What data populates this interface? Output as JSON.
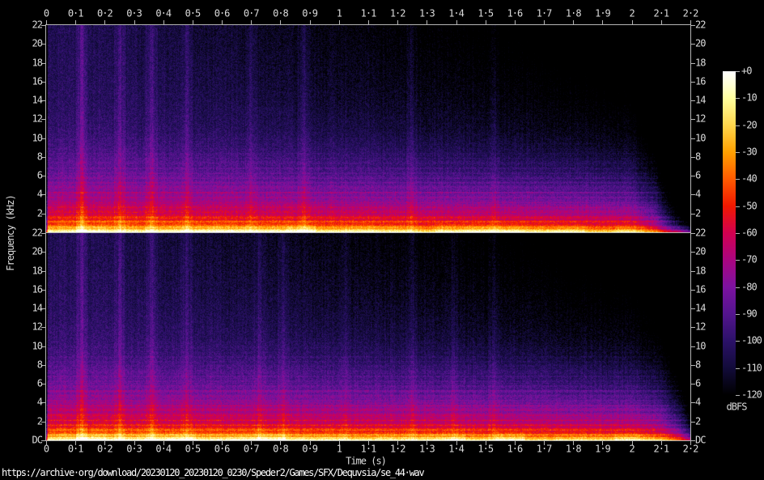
{
  "colors": {
    "background": "#000000",
    "text": "#dcdcdc",
    "axis": "#b4b4b4",
    "caption_text": "#ffffff"
  },
  "chart_data": {
    "type": "heatmap",
    "subtype": "audio-spectrogram-stereo",
    "xlabel": "Time (s)",
    "ylabel": "Frequency (kHz)",
    "x_range_s": [
      0,
      2.2
    ],
    "y_range_khz": [
      0,
      22
    ],
    "z_range_dbfs": [
      -120,
      0
    ],
    "x_ticks": [
      "0",
      "0·1",
      "0·2",
      "0·3",
      "0·4",
      "0·5",
      "0·6",
      "0·7",
      "0·8",
      "0·9",
      "1",
      "1·1",
      "1·2",
      "1·3",
      "1·4",
      "1·5",
      "1·6",
      "1·7",
      "1·8",
      "1·9",
      "2",
      "2·1",
      "2·2"
    ],
    "y_ticks_top_panel": [
      "22",
      "20",
      "18",
      "16",
      "14",
      "12",
      "10",
      "8",
      "6",
      "4",
      "2"
    ],
    "y_ticks_bottom_panel": [
      "22",
      "20",
      "18",
      "16",
      "14",
      "12",
      "10",
      "8",
      "6",
      "4",
      "2",
      "DC"
    ],
    "colorbar": {
      "unit": "dBFS",
      "ticks": [
        "+0",
        "-10",
        "-20",
        "-30",
        "-40",
        "-50",
        "-60",
        "-70",
        "-80",
        "-90",
        "-100",
        "-110",
        "-120"
      ],
      "palette": [
        {
          "db": 0,
          "color": "#ffffff"
        },
        {
          "db": -5,
          "color": "#ffffd5"
        },
        {
          "db": -10,
          "color": "#ffff9e"
        },
        {
          "db": -20,
          "color": "#ffd64c"
        },
        {
          "db": -30,
          "color": "#ffa000"
        },
        {
          "db": -40,
          "color": "#ff5a00"
        },
        {
          "db": -50,
          "color": "#f01800"
        },
        {
          "db": -60,
          "color": "#d20050"
        },
        {
          "db": -70,
          "color": "#aa0580"
        },
        {
          "db": -80,
          "color": "#7c12a0"
        },
        {
          "db": -90,
          "color": "#53148e"
        },
        {
          "db": -100,
          "color": "#2b1168"
        },
        {
          "db": -110,
          "color": "#120b3a"
        },
        {
          "db": -120,
          "color": "#000000"
        }
      ]
    },
    "freq_profile_khz_dbfs": [
      [
        22,
        -103
      ],
      [
        18,
        -102
      ],
      [
        14,
        -100
      ],
      [
        11,
        -97
      ],
      [
        9,
        -93
      ],
      [
        7,
        -87
      ],
      [
        5.5,
        -81
      ],
      [
        4,
        -74
      ],
      [
        3,
        -68
      ],
      [
        2.2,
        -61
      ],
      [
        1.6,
        -54
      ],
      [
        1.1,
        -46
      ],
      [
        0.8,
        -39
      ],
      [
        0.55,
        -32
      ],
      [
        0.35,
        -24
      ],
      [
        0.2,
        -16
      ],
      [
        0.1,
        -10
      ],
      [
        0,
        -8
      ]
    ],
    "panels": [
      {
        "channel": "left",
        "seed": 7,
        "envelope_s_dbfs": [
          [
            0,
            -2
          ],
          [
            0.06,
            0
          ],
          [
            0.6,
            -3
          ],
          [
            1.2,
            -7
          ],
          [
            1.7,
            -11
          ],
          [
            2.0,
            -15
          ],
          [
            2.08,
            -30
          ],
          [
            2.14,
            -60
          ],
          [
            2.2,
            -90
          ]
        ],
        "transients_s_db": [
          [
            0.12,
            16
          ],
          [
            0.25,
            13
          ],
          [
            0.36,
            12
          ],
          [
            0.48,
            11
          ],
          [
            0.7,
            6
          ],
          [
            0.88,
            9
          ],
          [
            1.25,
            8
          ],
          [
            1.53,
            5
          ]
        ]
      },
      {
        "channel": "right",
        "seed": 42,
        "envelope_s_dbfs": [
          [
            0,
            -2
          ],
          [
            0.06,
            0
          ],
          [
            0.6,
            -3
          ],
          [
            1.2,
            -6
          ],
          [
            1.7,
            -10
          ],
          [
            2.0,
            -13
          ],
          [
            2.1,
            -20
          ],
          [
            2.16,
            -38
          ],
          [
            2.2,
            -60
          ]
        ],
        "transients_s_db": [
          [
            0.12,
            14
          ],
          [
            0.25,
            12
          ],
          [
            0.36,
            11
          ],
          [
            0.48,
            10
          ],
          [
            0.73,
            9
          ],
          [
            0.81,
            8
          ],
          [
            1.02,
            5
          ],
          [
            1.25,
            7
          ],
          [
            1.39,
            8
          ],
          [
            1.53,
            7
          ]
        ]
      }
    ],
    "source_caption": "https://archive·org/download/20230120_20230120_0230/Speder2/Games/SFX/Dequvsia/se_44·wav"
  }
}
